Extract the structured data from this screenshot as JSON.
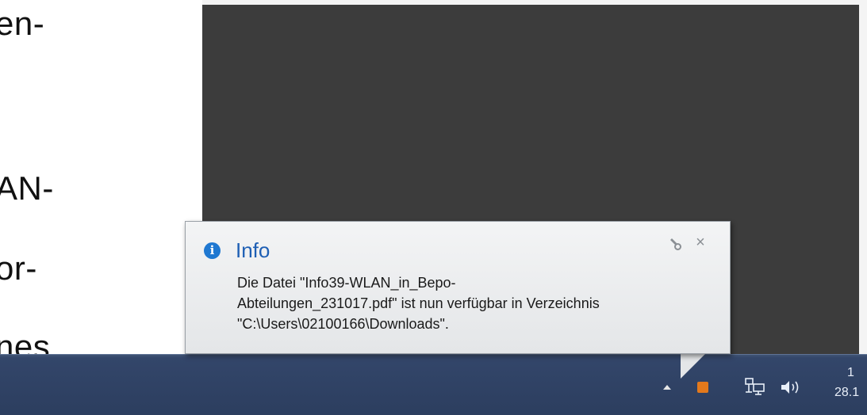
{
  "document": {
    "fragments": [
      "en-",
      "AN-",
      "or-",
      "nes"
    ]
  },
  "notification": {
    "title": "Info",
    "message_line1": "Die Datei \"Info39-WLAN_in_Bepo-",
    "message_line2": "Abteilungen_231017.pdf\" ist nun verfügbar in Verzeichnis",
    "message_line3": "\"C:\\Users\\02100166\\Downloads\".",
    "icons": [
      "info-icon",
      "settings-icon",
      "close-icon"
    ],
    "close_glyph": "×"
  },
  "taskbar": {
    "clock_time": "1",
    "clock_date": "28.1",
    "tray_icons": [
      "show-hidden-icons-arrow",
      "pdf-download-icon",
      "network-icon",
      "volume-icon"
    ]
  },
  "colors": {
    "taskbar": "#2c3e5f",
    "balloon_title": "#1e5fb4",
    "info_icon": "#1f78d1",
    "pdf_icon": "#e3791c"
  }
}
